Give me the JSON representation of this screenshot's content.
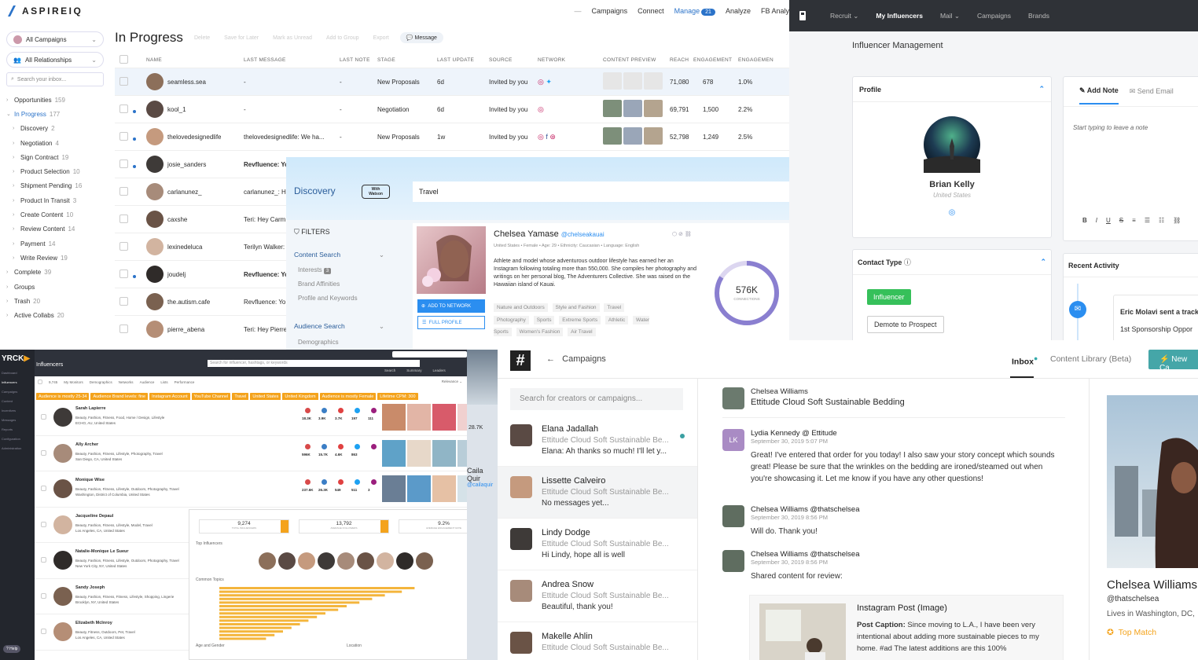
{
  "panelA": {
    "logo": "ASPIREIQ",
    "nav": [
      "Campaigns",
      "Connect",
      "Manage",
      "Analyze",
      "FB Analy"
    ],
    "manage_badge": "21",
    "title": "In Progress",
    "toolbar": [
      "Delete",
      "Save for Later",
      "Mark as Unread",
      "Add to Group",
      "Export"
    ],
    "message_btn": "Message",
    "dd1": "All Campaigns",
    "dd2": "All Relationships",
    "search_placeholder": "Search your inbox...",
    "tree": [
      {
        "label": "Opportunities",
        "count": "159",
        "lvl": 0
      },
      {
        "label": "In Progress",
        "count": "177",
        "lvl": 0,
        "active": true
      },
      {
        "label": "Discovery",
        "count": "2",
        "lvl": 1
      },
      {
        "label": "Negotiation",
        "count": "4",
        "lvl": 1
      },
      {
        "label": "Sign Contract",
        "count": "19",
        "lvl": 1
      },
      {
        "label": "Product Selection",
        "count": "10",
        "lvl": 1
      },
      {
        "label": "Shipment Pending",
        "count": "16",
        "lvl": 1
      },
      {
        "label": "Product In Transit",
        "count": "3",
        "lvl": 1
      },
      {
        "label": "Create Content",
        "count": "10",
        "lvl": 1
      },
      {
        "label": "Review Content",
        "count": "14",
        "lvl": 1
      },
      {
        "label": "Payment",
        "count": "14",
        "lvl": 1
      },
      {
        "label": "Write Review",
        "count": "19",
        "lvl": 1
      },
      {
        "label": "Complete",
        "count": "39",
        "lvl": 0
      },
      {
        "label": "Groups",
        "count": "",
        "lvl": 0
      },
      {
        "label": "Trash",
        "count": "20",
        "lvl": 0
      },
      {
        "label": "Active Collabs",
        "count": "20",
        "lvl": 0
      }
    ],
    "headers": [
      "NAME",
      "LAST MESSAGE",
      "LAST NOTE",
      "STAGE",
      "LAST UPDATE",
      "SOURCE",
      "NETWORK",
      "CONTENT PREVIEW",
      "REACH",
      "ENGAGEMENT",
      "ENGAGEMEN"
    ],
    "rows": [
      {
        "name": "seamless.sea",
        "msg": "-",
        "note": "-",
        "stage": "New Proposals",
        "upd": "6d",
        "src": "Invited by you",
        "reach": "71,080",
        "eng": "678",
        "rate": "1.0%",
        "dot": false,
        "sel": true
      },
      {
        "name": "kool_1",
        "msg": "-",
        "note": "-",
        "stage": "Negotiation",
        "upd": "6d",
        "src": "Invited by you",
        "reach": "69,791",
        "eng": "1,500",
        "rate": "2.2%",
        "dot": true
      },
      {
        "name": "thelovedesignedlife",
        "msg": "thelovedesignedlife: We ha...",
        "note": "-",
        "stage": "New Proposals",
        "upd": "1w",
        "src": "Invited by you",
        "reach": "52,798",
        "eng": "1,249",
        "rate": "2.5%",
        "dot": true
      },
      {
        "name": "josie_sanders",
        "msg": "Revfluence: Yo",
        "dot": true
      },
      {
        "name": "carlanunez_",
        "msg": "carlanunez_: H"
      },
      {
        "name": "caxshe",
        "msg": "Teri: Hey Carm"
      },
      {
        "name": "lexinedeluca",
        "msg": "Terilyn Walker:"
      },
      {
        "name": "joudelj",
        "msg": "Revfluence: Yo",
        "dot": true
      },
      {
        "name": "the.autism.cafe",
        "msg": "Revfluence: Yo"
      },
      {
        "name": "pierre_abena",
        "msg": "Teri: Hey Pierre"
      }
    ]
  },
  "panelB": {
    "nav": [
      "Recruit",
      "My Influencers",
      "Mail",
      "Campaigns",
      "Brands"
    ],
    "title": "Influencer Management",
    "profile_label": "Profile",
    "name": "Brian Kelly",
    "location": "United States",
    "add_note": "Add Note",
    "send_email": "Send Email",
    "note_placeholder": "Start typing to leave a note",
    "contact_type": "Contact Type",
    "influencer_badge": "Influencer",
    "demote": "Demote to Prospect",
    "recent": "Recent Activity",
    "activity1": "Eric Molavi sent a track",
    "activity2": "1st Sponsorship Oppor"
  },
  "panelC": {
    "title": "Discovery",
    "watson": "With Watson",
    "search": "Travel",
    "filters": "FILTERS",
    "content_search": "Content Search",
    "sub": [
      "Interests",
      "Brand Affinities",
      "Profile and Keywords"
    ],
    "interests_count": "3",
    "audience": "Audience Search",
    "demographics": "Demographics",
    "name": "Chelsea Yamase",
    "handle": "@chelseakauai",
    "meta": "United States  •  Female  •  Age: 29  •  Ethnicity: Caucasian  •  Language: English",
    "bio": "Athlete and model whose adventurous outdoor lifestyle has earned her an Instagram following totaling more than 550,000. She compiles her photography and writings on her personal blog, The Adventurers Collective. She was raised on the Hawaiian island of Kauai.",
    "add_btn": "ADD TO NETWORK",
    "full_btn": "FULL PROFILE",
    "tags": [
      "Nature and Outdoors",
      "Style and Fashion",
      "Travel",
      "Photography",
      "Sports",
      "Extreme Sports",
      "Athletic",
      "Water Sports",
      "Women's Fashion",
      "Air Travel"
    ],
    "connections": "576K",
    "conn_label": "CONNECTIONS"
  },
  "panelD": {
    "brand": "YRCK",
    "title": "Influencers",
    "search_placeholder": "Search for influencer, hashtags, or keywords",
    "tabs": [
      "Search",
      "Summary",
      "Leaders"
    ],
    "side": [
      "Dashboard",
      "Influencers",
      "Campaigns",
      "Content",
      "Incentives",
      "Messages",
      "Reports",
      "Configuration",
      "Administration"
    ],
    "help": "Help",
    "filters": [
      "Audience is mostly 25-34",
      "Audience Brand levels: fine",
      "Instagram Account",
      "YouTube Channel",
      "Travel",
      "United States",
      "United Kingdom",
      "Audience is mostly Female",
      "Lifetime CPM: 300"
    ],
    "rows": [
      {
        "name": "Sarah Lapierre",
        "sub": "Beauty, Fashion, Fitness, Food, Home / Design, Lifestyle",
        "loc": "ECHO, AU, United States",
        "stats": [
          "18.3K",
          "3.9K",
          "3.7K",
          "197",
          "111"
        ]
      },
      {
        "name": "Ally Archer",
        "sub": "Beauty, Fashion, Fitness, Lifestyle, Photography, Travel",
        "loc": "San Diego, CA, United States",
        "stats": [
          "596K",
          "15.7K",
          "4.6K",
          "863",
          ""
        ]
      },
      {
        "name": "Monique Wise",
        "sub": "Beauty, Fashion, Fitness, Lifestyle, Outdoors, Photography, Travel",
        "loc": "Washington, District of Columbia, United States",
        "stats": [
          "237.6K",
          "26.3K",
          "549",
          "511",
          "3"
        ]
      },
      {
        "name": "Jacqueline Depaul",
        "sub": "Beauty, Fashion, Fitness, Lifestyle, Model, Travel",
        "loc": "Los Angeles, CA, United States"
      },
      {
        "name": "Natalie-Monique Le Sueur",
        "sub": "Beauty, Fashion, Fitness, Lifestyle, Outdoors, Photography, Travel",
        "loc": "New York City, NY, United States"
      },
      {
        "name": "Sandy Joseph",
        "sub": "Beauty, Fashion, Fitness, Fitness, Lifestyle, Shopping, Lingerie",
        "loc": "Brooklyn, NY, United States"
      },
      {
        "name": "Elizabeth McInroy",
        "sub": "Beauty, Fitness, Outdoors, Pet, Travel",
        "loc": "Los Angeles, CA, United States"
      }
    ]
  },
  "panelF": {
    "stats": [
      {
        "v": "9,274",
        "l": "TOTAL INFLUENCERS"
      },
      {
        "v": "13,792",
        "l": "AVERAGE FOLLOWERS"
      },
      {
        "v": "9.2%",
        "l": "AVERAGE ENGAGEMENT RATE"
      }
    ],
    "top": "Top Influencers",
    "topics": "Common Topics",
    "age": "Age and Gender",
    "loc": "Location",
    "bars": [
      0.92,
      0.86,
      0.78,
      0.72,
      0.66,
      0.6,
      0.56,
      0.5,
      0.46,
      0.42,
      0.38,
      0.34,
      0.3,
      0.26,
      0.22
    ]
  },
  "panelE": {
    "back": "Campaigns",
    "tabs": [
      "Inbox",
      "Content Library (Beta)"
    ],
    "new_btn": "New Ca",
    "search_placeholder": "Search for creators or campaigns...",
    "convs": [
      {
        "name": "Elana Jadallah",
        "camp": "Ettitude Cloud Soft Sustainable Be...",
        "prev": "Elana: Ah thanks so much! I'll let y...",
        "unread": true
      },
      {
        "name": "Lissette Calveiro",
        "camp": "Ettitude Cloud Soft Sustainable Be...",
        "prev": "No messages yet...",
        "sel": true
      },
      {
        "name": "Lindy Dodge",
        "camp": "Ettitude Cloud Soft Sustainable Be...",
        "prev": "Hi Lindy, hope all is well"
      },
      {
        "name": "Andrea Snow",
        "camp": "Ettitude Cloud Soft Sustainable Be...",
        "prev": "Beautiful, thank you!"
      },
      {
        "name": "Makelle Ahlin",
        "camp": "Ettitude Cloud Soft Sustainable Be...",
        "prev": ""
      }
    ],
    "thread_name": "Chelsea Williams",
    "thread_camp": "Ettitude Cloud Soft Sustainable Bedding",
    "msgs": [
      {
        "who": "Lydia Kennedy @ Ettitude",
        "date": "September 30, 2019 5:07 PM",
        "body": "Great! I've entered that order for you today! I also saw your story concept which sounds great! Please be sure that the wrinkles on the bedding are ironed/steamed out when you're showcasing it. Let me know if you have any other questions!",
        "init": "LK"
      },
      {
        "who": "Chelsea Williams @thatschelsea",
        "date": "September 30, 2019 8:56 PM",
        "body": "Will do. Thank you!"
      },
      {
        "who": "Chelsea Williams @thatschelsea",
        "date": "September 30, 2019 8:56 PM",
        "body": "Shared content for review:"
      }
    ],
    "post_title": "Instagram Post (Image)",
    "post_caption_label": "Post Caption:",
    "post_caption": "Since moving to L.A., I have been very intentional about adding more sustainable pieces to my home. #ad The latest additions are this 100%",
    "profile_name": "Chelsea Williams",
    "profile_handle": "@thatschelsea",
    "profile_loc": "Lives in Washington, DC,",
    "top_match": "Top Match"
  },
  "fragments": {
    "a": "28.7K",
    "b": "Caila Quir",
    "c": "@cailaquir"
  }
}
